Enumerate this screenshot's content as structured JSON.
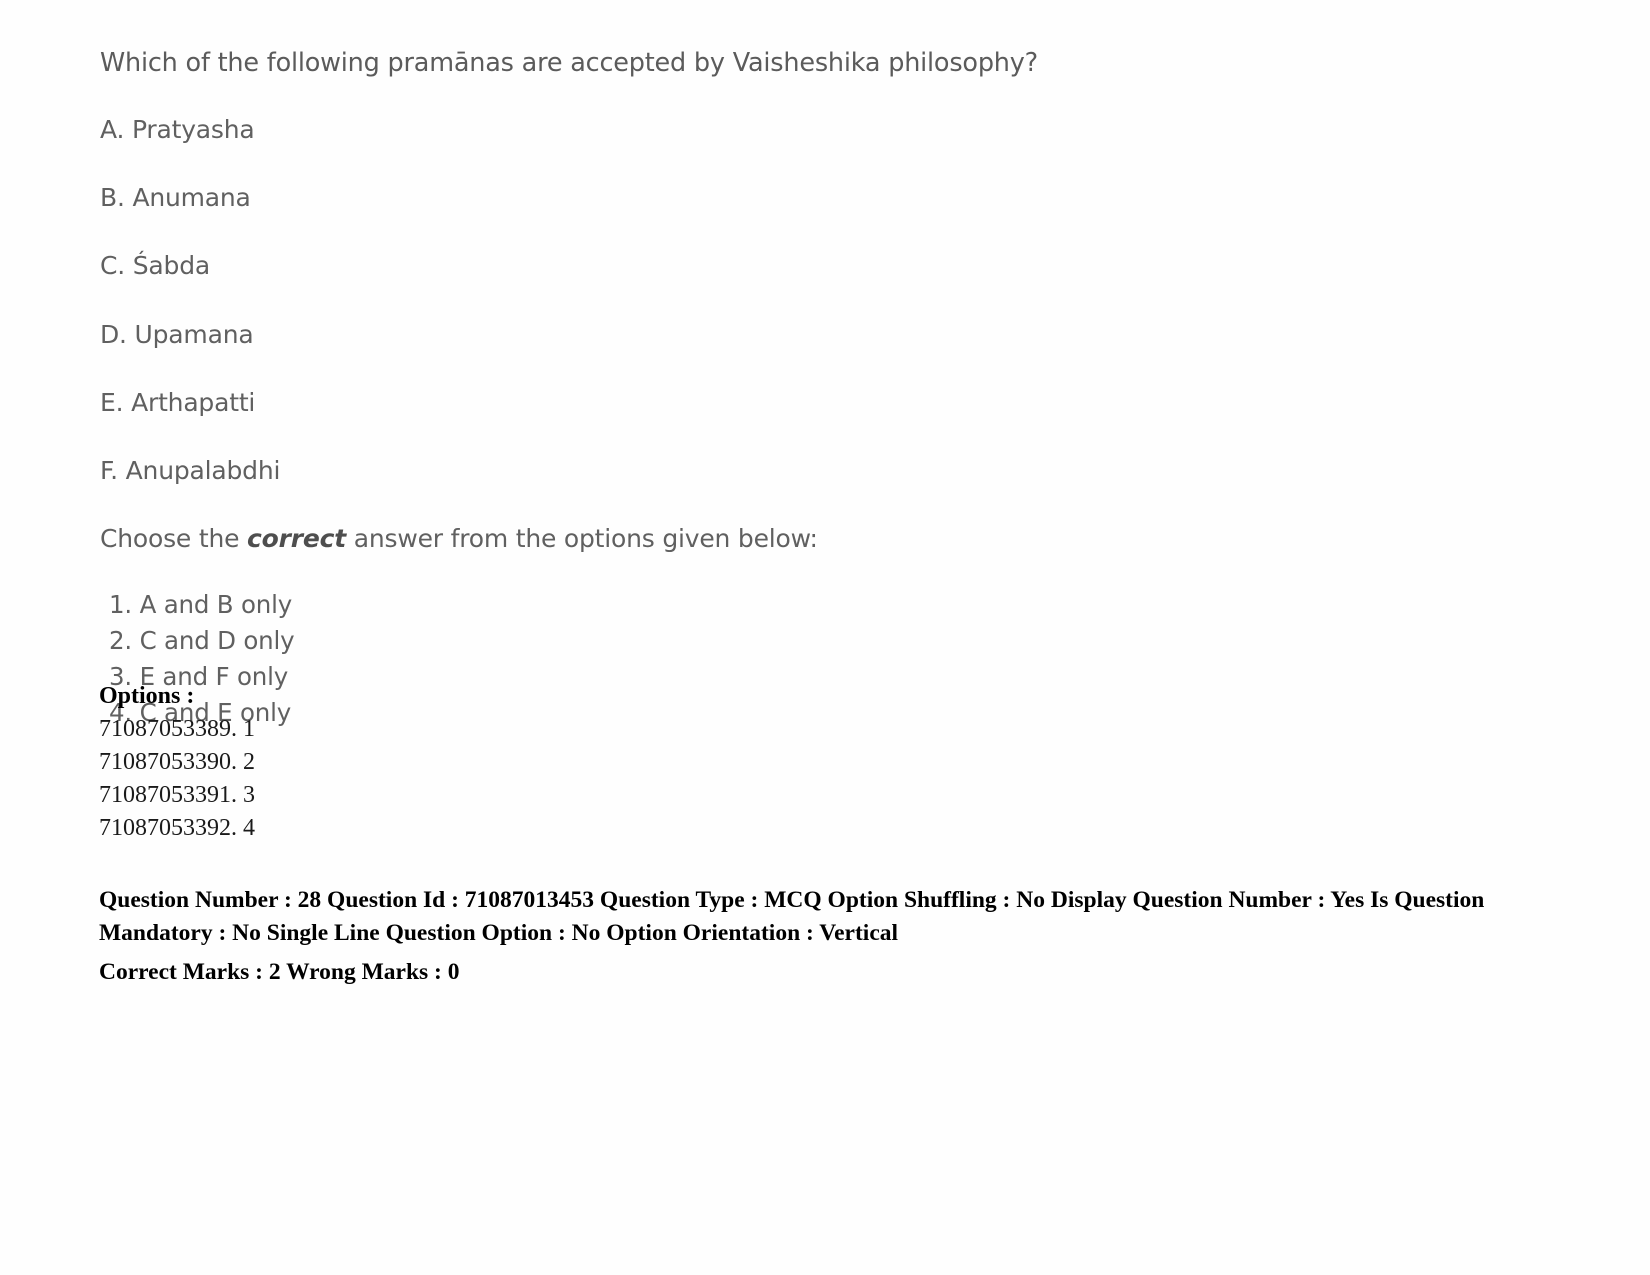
{
  "question": {
    "text": "Which of the following pramānas are accepted by Vaisheshika philosophy?",
    "items": [
      "A. Pratyasha",
      "B. Anumana",
      "C. Śabda",
      "D. Upamana",
      "E. Arthapatti",
      "F. Anupalabdhi"
    ],
    "choose_prefix": "Choose the ",
    "choose_emphasis": "correct",
    "choose_suffix": " answer from the options given below:",
    "choices": [
      "1. A and B only",
      "2. C and D only",
      "3. E and F only",
      "4. C and E only"
    ]
  },
  "options_block": {
    "label": "Options :",
    "entries": [
      "71087053389. 1",
      "71087053390. 2",
      "71087053391. 3",
      "71087053392. 4"
    ]
  },
  "metadata": {
    "line1": "Question Number : 28 Question Id : 71087013453 Question Type : MCQ Option Shuffling : No Display Question Number : Yes Is Question Mandatory : No Single Line Question Option : No Option Orientation : Vertical",
    "line2": "Correct Marks : 2 Wrong Marks : 0"
  }
}
